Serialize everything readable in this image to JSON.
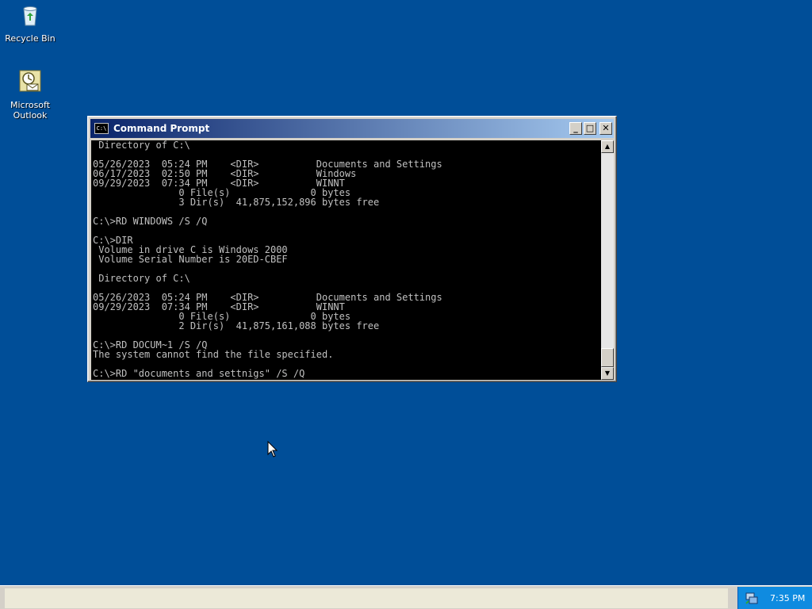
{
  "desktop": {
    "icons": [
      {
        "label": "Recycle Bin",
        "icon": "recycle-bin-icon"
      },
      {
        "label": "Microsoft\nOutlook",
        "icon": "outlook-icon"
      }
    ],
    "background_color": "#004e98"
  },
  "window": {
    "title": "Command Prompt",
    "buttons": {
      "minimize": "_",
      "maximize": "□",
      "close": "✕"
    },
    "console_lines": [
      " Directory of C:\\",
      "",
      "05/26/2023  05:24 PM    <DIR>          Documents and Settings",
      "06/17/2023  02:50 PM    <DIR>          Windows",
      "09/29/2023  07:34 PM    <DIR>          WINNT",
      "               0 File(s)              0 bytes",
      "               3 Dir(s)  41,875,152,896 bytes free",
      "",
      "C:\\>RD WINDOWS /S /Q",
      "",
      "C:\\>DIR",
      " Volume in drive C is Windows 2000",
      " Volume Serial Number is 20ED-CBEF",
      "",
      " Directory of C:\\",
      "",
      "05/26/2023  05:24 PM    <DIR>          Documents and Settings",
      "09/29/2023  07:34 PM    <DIR>          WINNT",
      "               0 File(s)              0 bytes",
      "               2 Dir(s)  41,875,161,088 bytes free",
      "",
      "C:\\>RD DOCUM~1 /S /Q",
      "The system cannot find the file specified.",
      "",
      "C:\\>RD \"documents and settnigs\" /S /Q"
    ]
  },
  "taskbar": {
    "clock": "7:35 PM",
    "tray_icon": "network-tray-icon"
  }
}
